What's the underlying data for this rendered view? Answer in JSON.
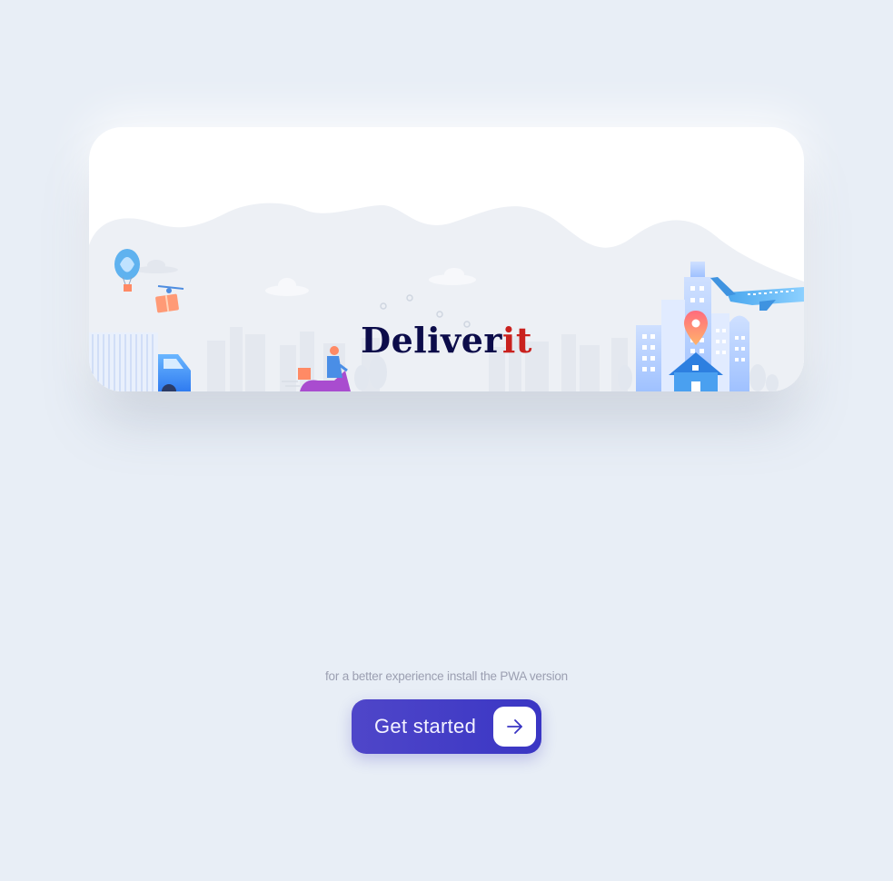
{
  "brand": {
    "name_main": "Deliver",
    "name_accent": "it",
    "accent_color": "#c9211e",
    "main_color": "#0c0c4a"
  },
  "install_note": "for a better experience install the PWA version",
  "cta": {
    "label": "Get started",
    "icon": "arrow-right-icon",
    "color": "#4f46c9"
  },
  "illustration": {
    "icons": [
      "hot-air-balloon-icon",
      "drone-package-icon",
      "truck-icon",
      "scooter-courier-icon",
      "location-pin-icon",
      "house-icon",
      "airplane-icon",
      "cloud-icon",
      "city-skyline"
    ]
  }
}
